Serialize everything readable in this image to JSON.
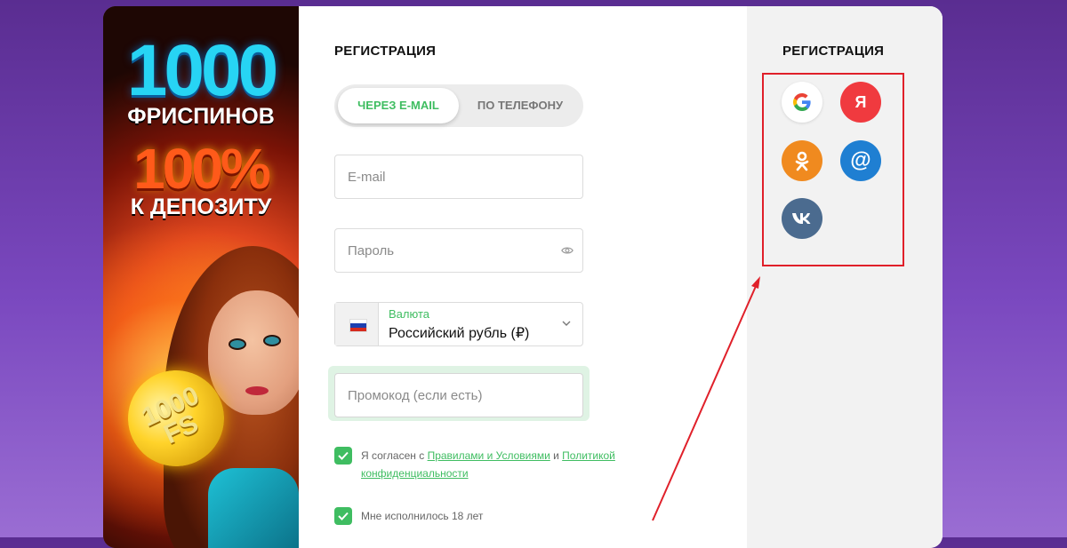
{
  "banner": {
    "headline_number": "1000",
    "headline_text": "ФРИСПИНОВ",
    "bonus_percent": "100%",
    "bonus_text": "К ДЕПОЗИТУ",
    "coin_text": "1000 FS"
  },
  "form": {
    "title": "РЕГИСТРАЦИЯ",
    "tabs": [
      {
        "label": "ЧЕРЕЗ E-MAIL",
        "active": true
      },
      {
        "label": "ПО ТЕЛЕФОНУ",
        "active": false
      }
    ],
    "email_placeholder": "E-mail",
    "password_placeholder": "Пароль",
    "currency": {
      "label": "Валюта",
      "value": "Российский рубль (₽)",
      "flag": "russia-flag"
    },
    "promo_placeholder": "Промокод (если есть)",
    "terms": {
      "prefix": "Я согласен с ",
      "rules_link": "Правилами и Условиями",
      "middle": " и ",
      "privacy_link": "Политикой конфиденциальности",
      "checked": true
    },
    "age": {
      "label": "Мне исполнилось 18 лет",
      "checked": true
    }
  },
  "social": {
    "title": "РЕГИСТРАЦИЯ",
    "providers": [
      {
        "name": "google",
        "icon": "google-icon"
      },
      {
        "name": "yandex",
        "icon": "yandex-icon",
        "label": "Я"
      },
      {
        "name": "odnoklassniki",
        "icon": "ok-icon"
      },
      {
        "name": "mail-ru",
        "icon": "mail-at-icon",
        "label": "@"
      },
      {
        "name": "vkontakte",
        "icon": "vk-icon"
      }
    ]
  },
  "colors": {
    "accent_green": "#3fbd61",
    "annotation_red": "#e0202a",
    "background_purple": "#6a3aa8"
  }
}
